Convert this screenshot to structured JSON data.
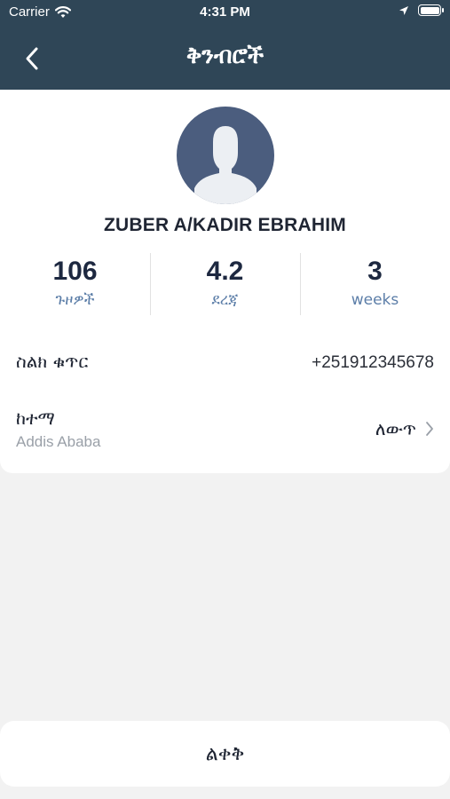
{
  "status_bar": {
    "carrier": "Carrier",
    "time": "4:31 PM"
  },
  "header": {
    "title": "ቅንብሮች",
    "background_color": "#2f4657"
  },
  "profile": {
    "name": "ZUBER A/KADIR EBRAHIM",
    "avatar_color": "#4b5d7e"
  },
  "stats": [
    {
      "value": "106",
      "label": "ጉዞዎች"
    },
    {
      "value": "4.2",
      "label": "ደረጃ"
    },
    {
      "value": "3",
      "label": "weeks"
    }
  ],
  "phone_row": {
    "label": "ስልክ ቁጥር",
    "value": "+251912345678"
  },
  "city_row": {
    "label": "ከተማ",
    "value": "Addis Ababa",
    "action_label": "ለውጥ"
  },
  "leave_button": {
    "label": "ልቀቅ"
  },
  "colors": {
    "stat_label": "#5c7ea8",
    "page_background": "#f2f2f2"
  }
}
